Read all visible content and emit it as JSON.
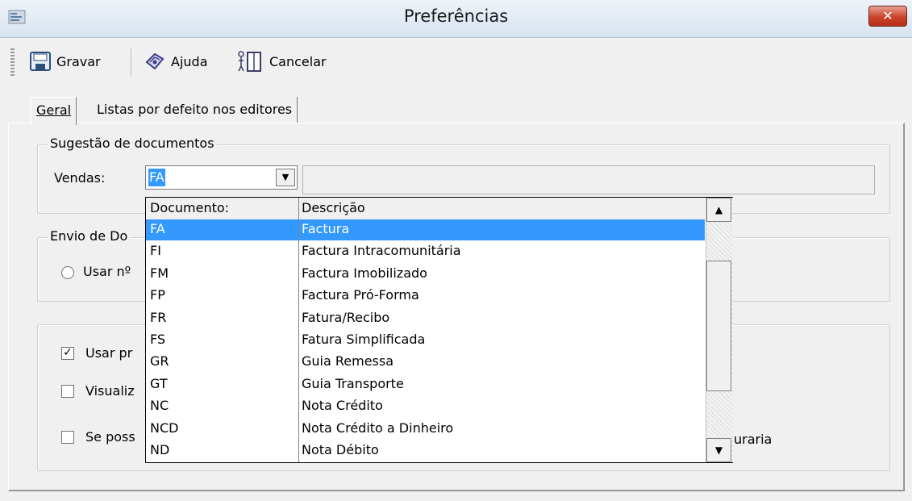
{
  "window": {
    "title": "Preferências",
    "close_label": "✕"
  },
  "toolbar": {
    "save_label": "Gravar",
    "help_label": "Ajuda",
    "cancel_label": "Cancelar"
  },
  "tabs": [
    {
      "label": "Geral"
    },
    {
      "label": "Listas por defeito nos editores"
    }
  ],
  "suggestion_group": {
    "title": "Sugestão de documentos",
    "sales_label": "Vendas:",
    "sales_value": "FA",
    "description_value": ""
  },
  "send_group": {
    "title": "Envio de Do",
    "radio_label": "Usar nº"
  },
  "options": {
    "use_label": "Usar pr",
    "use_checked": true,
    "visualize_label": "Visualiz",
    "visualize_checked": false,
    "if_possible_label": "Se poss",
    "if_possible_checked": false,
    "trailing_text": "uraria"
  },
  "dropdown": {
    "col_document": "Documento:",
    "col_description": "Descrição",
    "selected_index": 0,
    "rows": [
      {
        "doc": "FA",
        "desc": "Factura"
      },
      {
        "doc": "FI",
        "desc": "Factura Intracomunitária"
      },
      {
        "doc": "FM",
        "desc": "Factura Imobilizado"
      },
      {
        "doc": "FP",
        "desc": "Factura Pró-Forma"
      },
      {
        "doc": "FR",
        "desc": "Fatura/Recibo"
      },
      {
        "doc": "FS",
        "desc": "Fatura Simplificada"
      },
      {
        "doc": "GR",
        "desc": "Guia Remessa"
      },
      {
        "doc": "GT",
        "desc": "Guia Transporte"
      },
      {
        "doc": "NC",
        "desc": "Nota Crédito"
      },
      {
        "doc": "NCD",
        "desc": "Nota Crédito a Dinheiro"
      },
      {
        "doc": "ND",
        "desc": "Nota Débito"
      }
    ]
  },
  "colors": {
    "selection": "#3399ff",
    "close_red": "#c9432d"
  },
  "icons": {
    "app": "app-icon",
    "save": "floppy-disk-icon",
    "help": "help-book-icon",
    "cancel": "cancel-door-icon",
    "dropdown": "chevron-down-icon",
    "scroll_up": "scroll-up-arrow-icon",
    "scroll_down": "scroll-down-arrow-icon"
  }
}
